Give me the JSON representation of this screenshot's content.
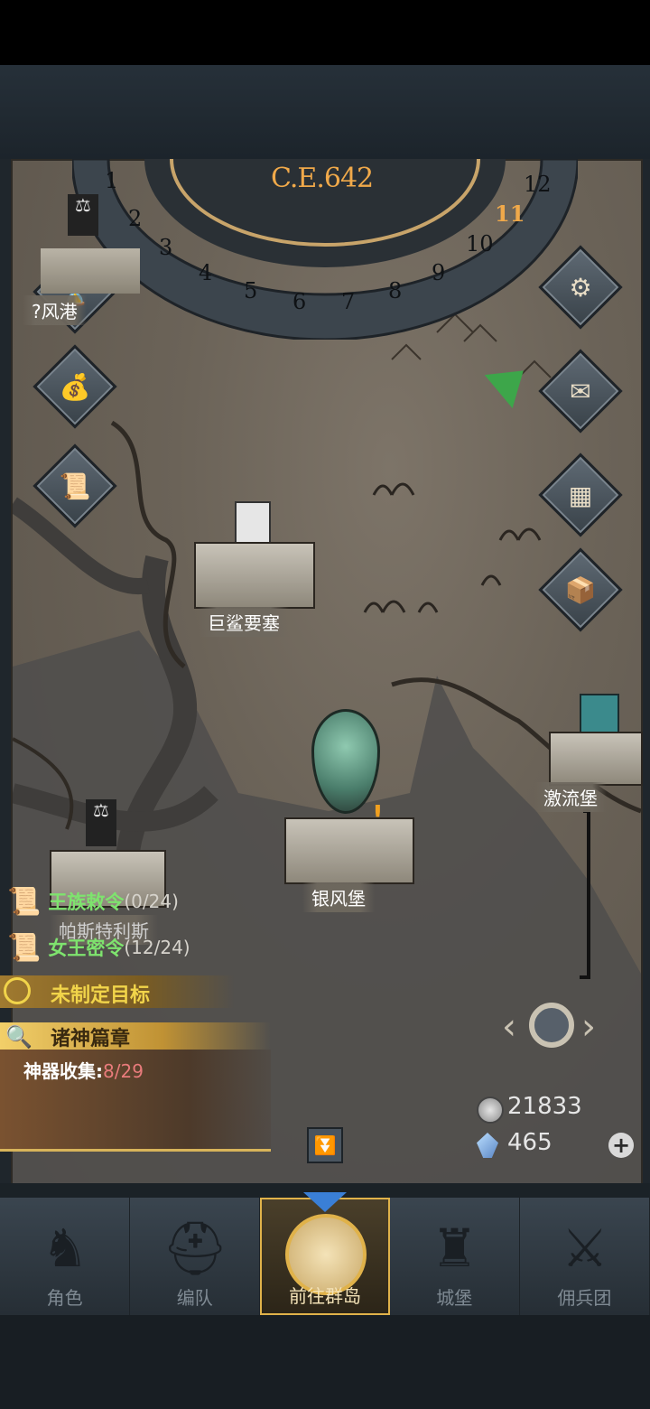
{
  "calendar": {
    "year": "C.E.642",
    "months": [
      "1",
      "2",
      "3",
      "4",
      "5",
      "6",
      "7",
      "8",
      "9",
      "10",
      "11",
      "12"
    ],
    "current_month": "11"
  },
  "left_buttons": [
    {
      "icon": "hourglass-icon"
    },
    {
      "icon": "money-bag-icon"
    },
    {
      "icon": "scroll-icon"
    }
  ],
  "right_buttons": [
    {
      "icon": "gear-icon"
    },
    {
      "icon": "mail-icon"
    },
    {
      "icon": "gate-icon"
    },
    {
      "icon": "supplies-icon"
    }
  ],
  "castles": {
    "top_left": "?风港",
    "shark": "巨鲨要塞",
    "silverwind": "银风堡",
    "torrent": "激流堡",
    "bottom_left": "帕斯特利斯"
  },
  "quests": {
    "royal_order": {
      "label": "王族敕令",
      "count": "(0/24)"
    },
    "queen_order": {
      "label": "女王密令",
      "count": "(12/24)"
    },
    "goal": "未制定目标",
    "gods": "诸神篇章",
    "artifact_label": "神器收集:",
    "artifact_value": "8/29"
  },
  "resources": {
    "silver": "21833",
    "crystal": "465"
  },
  "nav": [
    {
      "label": "角色",
      "icon": "knight-icon"
    },
    {
      "label": "编队",
      "icon": "helmet-icon"
    },
    {
      "label": "前往群岛",
      "icon": "globe-icon"
    },
    {
      "label": "城堡",
      "icon": "castle-icon"
    },
    {
      "label": "佣兵团",
      "icon": "mercenary-icon"
    }
  ],
  "colors": {
    "accent_gold": "#f0a94a",
    "quest_green": "#7ee36e",
    "artifact_red": "#e87b7b"
  }
}
